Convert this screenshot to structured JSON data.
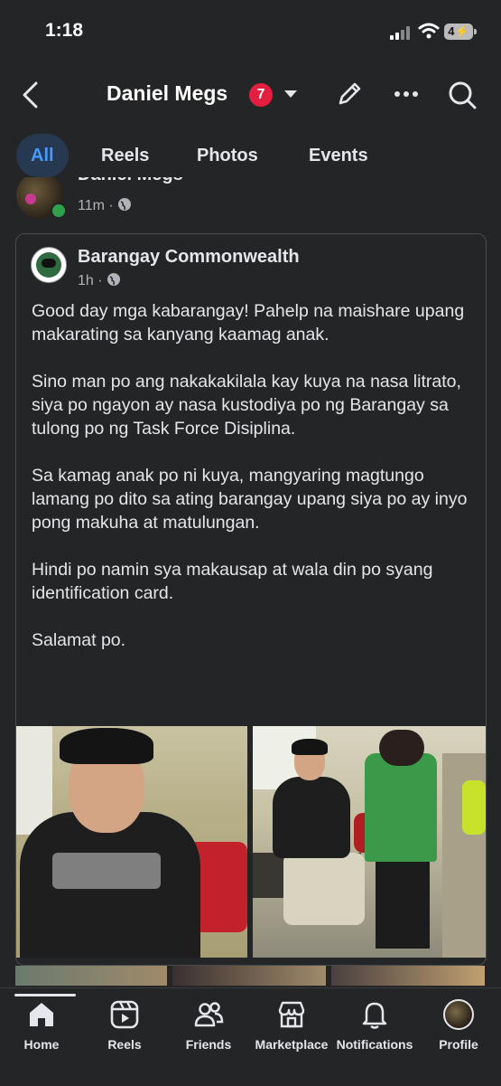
{
  "status_bar": {
    "time": "1:18",
    "battery": "4"
  },
  "header": {
    "title": "Daniel Megs",
    "badge": "7"
  },
  "tabs": [
    {
      "label": "All",
      "active": true
    },
    {
      "label": "Reels",
      "active": false
    },
    {
      "label": "Photos",
      "active": false
    },
    {
      "label": "Events",
      "active": false
    }
  ],
  "post": {
    "author_name": "Daniel Megs",
    "meta": "11m ·",
    "shared": {
      "page_name": "Barangay Commonwealth",
      "meta": "1h ·",
      "paragraphs": [
        "Good day mga kabarangay! Pahelp na maishare upang makarating sa kanyang kaamag anak.",
        "Sino man po ang nakakakilala kay kuya na nasa litrato, siya po ngayon ay nasa kustodiya po ng Barangay sa tulong po ng Task Force Disiplina.",
        "Sa kamag anak po ni kuya, mangyaring magtungo lamang po dito sa ating barangay upang siya po ay inyo pong makuha at matulungan.",
        "Hindi po namin sya makausap at wala din po syang identification card.",
        "Salamat po."
      ]
    }
  },
  "bottom_nav": [
    {
      "label": "Home",
      "icon": "home-icon",
      "active": true
    },
    {
      "label": "Reels",
      "icon": "reels-icon",
      "active": false
    },
    {
      "label": "Friends",
      "icon": "friends-icon",
      "active": false
    },
    {
      "label": "Marketplace",
      "icon": "marketplace-icon",
      "active": false
    },
    {
      "label": "Notifications",
      "icon": "bell-icon",
      "active": false
    },
    {
      "label": "Profile",
      "icon": "profile-avatar",
      "active": false
    }
  ],
  "colors": {
    "background": "#242526",
    "accent": "#4599ff",
    "badge": "#e41e3f",
    "online": "#31a24c"
  }
}
